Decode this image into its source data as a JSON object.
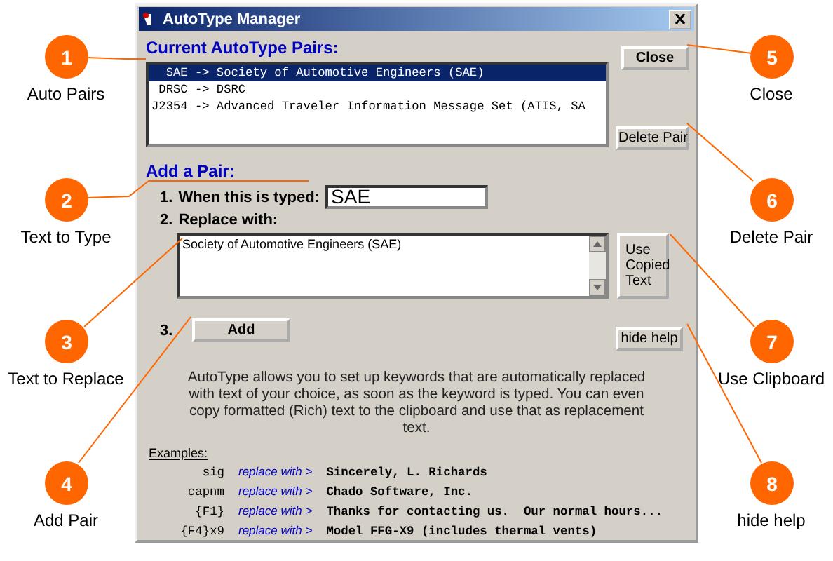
{
  "callouts": [
    {
      "number": "1",
      "label": "Auto Pairs"
    },
    {
      "number": "2",
      "label": "Text to Type"
    },
    {
      "number": "3",
      "label": "Text to Replace"
    },
    {
      "number": "4",
      "label": "Add Pair"
    },
    {
      "number": "5",
      "label": "Close"
    },
    {
      "number": "6",
      "label": "Delete Pair"
    },
    {
      "number": "7",
      "label": "Use Clipboard"
    },
    {
      "number": "8",
      "label": "hide help"
    }
  ],
  "window": {
    "title": "AutoType Manager",
    "pairs_heading": "Current AutoType Pairs:",
    "pairs": [
      {
        "text": "  SAE -> Society of Automotive Engineers (SAE)",
        "selected": true
      },
      {
        "text": " DRSC -> DSRC",
        "selected": false
      },
      {
        "text": "J2354 -> Advanced Traveler Information Message Set (ATIS, SA",
        "selected": false
      }
    ],
    "close_button": "Close",
    "delete_button": "Delete Pair",
    "add_heading": "Add a Pair:",
    "step1_number": "1.",
    "step1_label": "When this is typed:",
    "typed_value": "SAE",
    "step2_number": "2.",
    "step2_label": "Replace with:",
    "replacement_value": "Society of Automotive Engineers (SAE)",
    "use_copied_button": "Use Copied Text",
    "step3_number": "3.",
    "add_button": "Add",
    "hide_help_button": "hide help",
    "help_text": "AutoType allows you to set up keywords that are automatically replaced with text of your choice, as soon as the keyword is typed.  You can even copy formatted (Rich) text to the clipboard and use that as replacement text.",
    "examples_heading": "Examples:",
    "examples": [
      {
        "keyword": "sig",
        "arrow": "replace with >",
        "replacement": "Sincerely, L. Richards"
      },
      {
        "keyword": "capnm",
        "arrow": "replace with >",
        "replacement": "Chado Software, Inc."
      },
      {
        "keyword": "{F1}",
        "arrow": "replace with >",
        "replacement": "Thanks for contacting us.  Our normal hours..."
      },
      {
        "keyword": "{F4}x9",
        "arrow": "replace with >",
        "replacement": "Model FFG-X9 (includes thermal vents)"
      }
    ]
  }
}
